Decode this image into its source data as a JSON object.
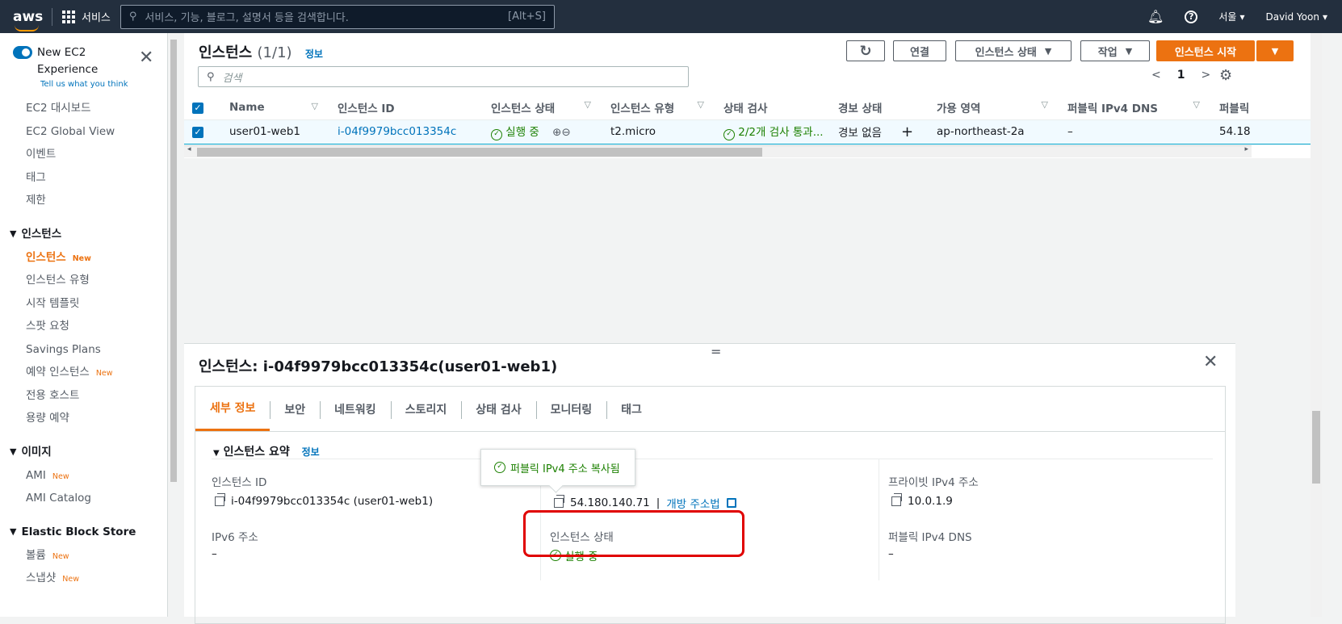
{
  "topnav": {
    "logo": "aws",
    "services": "서비스",
    "search_placeholder": "서비스, 기능, 블로그, 설명서 등을 검색합니다.",
    "search_shortcut": "[Alt+S]",
    "region": "서울",
    "user": "David Yoon"
  },
  "sidebar": {
    "new_experience": "New EC2 Experience",
    "tell_us": "Tell us what you think",
    "top_items": [
      "EC2 대시보드",
      "EC2 Global View",
      "이벤트",
      "태그",
      "제한"
    ],
    "section_instances": "인스턴스",
    "instances_items": [
      {
        "label": "인스턴스",
        "new": "New",
        "active": true
      },
      {
        "label": "인스턴스 유형",
        "new": ""
      },
      {
        "label": "시작 템플릿",
        "new": ""
      },
      {
        "label": "스팟 요청",
        "new": ""
      },
      {
        "label": "Savings Plans",
        "new": ""
      },
      {
        "label": "예약 인스턴스",
        "new": "New"
      },
      {
        "label": "전용 호스트",
        "new": ""
      },
      {
        "label": "용량 예약",
        "new": ""
      }
    ],
    "section_images": "이미지",
    "images_items": [
      {
        "label": "AMI",
        "new": "New"
      },
      {
        "label": "AMI Catalog",
        "new": ""
      }
    ],
    "section_ebs": "Elastic Block Store",
    "ebs_items": [
      {
        "label": "볼륨",
        "new": "New"
      },
      {
        "label": "스냅샷",
        "new": "New"
      }
    ]
  },
  "main": {
    "title": "인스턴스",
    "count": "(1/1)",
    "info": "정보",
    "buttons": {
      "connect": "연결",
      "instance_state": "인스턴스 상태",
      "actions": "작업",
      "launch": "인스턴스 시작"
    },
    "filter_placeholder": "검색",
    "page": "1",
    "columns": [
      "Name",
      "인스턴스 ID",
      "인스턴스 상태",
      "인스턴스 유형",
      "상태 검사",
      "경보 상태",
      "가용 영역",
      "퍼블릭 IPv4 DNS",
      "퍼블릭"
    ],
    "rows": [
      {
        "name": "user01-web1",
        "id": "i-04f9979bcc013354c",
        "state": "실행 중",
        "type": "t2.micro",
        "check": "2/2개 검사 통과...",
        "alarm": "경보 없음",
        "az": "ap-northeast-2a",
        "dns": "–",
        "public": "54.18"
      }
    ]
  },
  "detail": {
    "title": "인스턴스: i-04f9979bcc013354c(user01-web1)",
    "tabs": [
      "세부 정보",
      "보안",
      "네트워킹",
      "스토리지",
      "상태 검사",
      "모니터링",
      "태그"
    ],
    "section": "인스턴스 요약",
    "section_info": "정보",
    "tooltip": "퍼블릭 IPv4 주소 복사됨",
    "instance_id_label": "인스턴스 ID",
    "instance_id_value": "i-04f9979bcc013354c (user01-web1)",
    "public_ip_value": "54.180.140.71",
    "open_address": "개방 주소법",
    "private_ip_label": "프라이빗 IPv4 주소",
    "private_ip_value": "10.0.1.9",
    "ipv6_label": "IPv6 주소",
    "ipv6_value": "–",
    "state_label": "인스턴스 상태",
    "state_value": "실행 중",
    "public_dns_label": "퍼블릭 IPv4 DNS",
    "public_dns_value": "–"
  },
  "colors": {
    "nav_bg": "#232f3e",
    "accent": "#ec7211",
    "link": "#0073bb",
    "success": "#1d8102",
    "highlight": "#e00000"
  }
}
